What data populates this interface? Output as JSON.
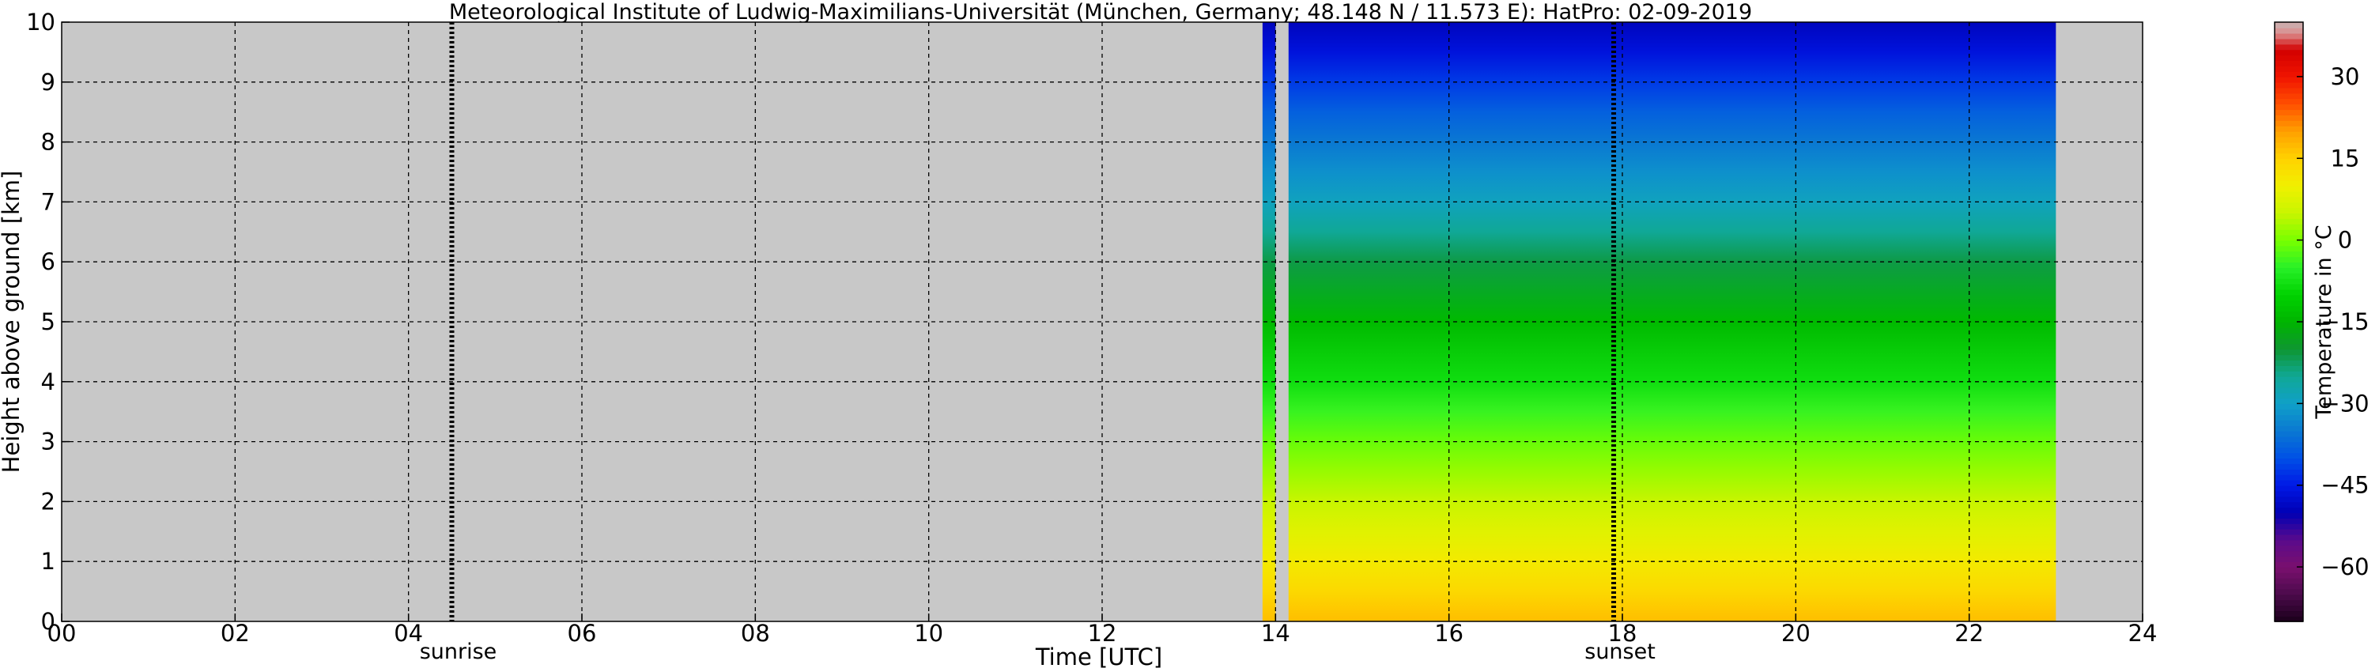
{
  "chart_data": {
    "type": "heatmap",
    "title": "Meteorological Institute of Ludwig-Maximilians-Universität (München, Germany; 48.148 N / 11.573 E):    HatPro: 02-09-2019",
    "xlabel": "Time [UTC]",
    "ylabel": "Height above ground [km]",
    "xlim": [
      0,
      24
    ],
    "ylim": [
      0,
      10
    ],
    "x_ticks": [
      0,
      2,
      4,
      6,
      8,
      10,
      12,
      14,
      16,
      18,
      20,
      22,
      24
    ],
    "x_tick_labels": [
      "00",
      "02",
      "04",
      "06",
      "08",
      "10",
      "12",
      "14",
      "16",
      "18",
      "20",
      "22",
      "24"
    ],
    "y_ticks": [
      0,
      1,
      2,
      3,
      4,
      5,
      6,
      7,
      8,
      9,
      10
    ],
    "y_tick_labels": [
      "0",
      "1",
      "2",
      "3",
      "4",
      "5",
      "6",
      "7",
      "8",
      "9",
      "10"
    ],
    "grid": true,
    "missing_color": "#c8c8c8",
    "data_segments": [
      {
        "t_start": 13.85,
        "t_end": 14.0
      },
      {
        "t_start": 14.15,
        "t_end": 23.0
      }
    ],
    "temperature_profile": {
      "height_km": [
        0,
        0.5,
        1,
        1.5,
        2,
        2.5,
        3,
        3.5,
        4,
        5,
        6,
        6.5,
        7,
        7.5,
        8,
        8.5,
        9,
        9.5,
        10
      ],
      "temperature_c": [
        17,
        14,
        11,
        8,
        5,
        2,
        -1,
        -4,
        -8,
        -14,
        -21,
        -25,
        -29,
        -32,
        -35,
        -38,
        -42,
        -46,
        -49
      ]
    },
    "events": [
      {
        "time": 4.5,
        "label": "sunrise"
      },
      {
        "time": 17.9,
        "label": "sunset"
      }
    ],
    "colorbar": {
      "label": "Temperature in °C",
      "range": [
        -70,
        40
      ],
      "ticks": [
        -60,
        -45,
        -30,
        -15,
        0,
        15,
        30
      ],
      "tick_labels": [
        "−60",
        "−45",
        "−30",
        "−15",
        "0",
        "15",
        "30"
      ],
      "stops": [
        {
          "t": -70,
          "color": "#1a001a"
        },
        {
          "t": -65,
          "color": "#4b0a4b"
        },
        {
          "t": -60,
          "color": "#7a0f6e"
        },
        {
          "t": -55,
          "color": "#5a0a8c"
        },
        {
          "t": -50,
          "color": "#0000b4"
        },
        {
          "t": -45,
          "color": "#0018e6"
        },
        {
          "t": -40,
          "color": "#0050e6"
        },
        {
          "t": -35,
          "color": "#0a78d2"
        },
        {
          "t": -30,
          "color": "#10a0c8"
        },
        {
          "t": -25,
          "color": "#10a896"
        },
        {
          "t": -20,
          "color": "#0e9632"
        },
        {
          "t": -15,
          "color": "#00b400"
        },
        {
          "t": -10,
          "color": "#00d200"
        },
        {
          "t": -5,
          "color": "#28f028"
        },
        {
          "t": 0,
          "color": "#78ff00"
        },
        {
          "t": 5,
          "color": "#c8f500"
        },
        {
          "t": 10,
          "color": "#f0f000"
        },
        {
          "t": 15,
          "color": "#ffd200"
        },
        {
          "t": 20,
          "color": "#ffa000"
        },
        {
          "t": 25,
          "color": "#ff5000"
        },
        {
          "t": 30,
          "color": "#f01400"
        },
        {
          "t": 35,
          "color": "#d20000"
        },
        {
          "t": 38,
          "color": "#dc8c8c"
        },
        {
          "t": 40,
          "color": "#c8b4b4"
        }
      ]
    }
  }
}
